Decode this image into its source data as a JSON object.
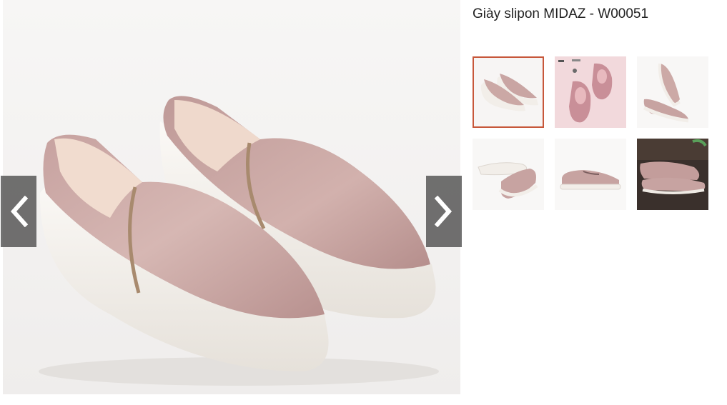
{
  "product": {
    "title": "Giày slipon MIDAZ - W00051"
  },
  "gallery": {
    "main_image_alt": "pink slip-on shoes",
    "prev_icon": "chevron-left-icon",
    "next_icon": "chevron-right-icon",
    "selected_index": 0,
    "thumbnails": [
      {
        "alt": "pair side view"
      },
      {
        "alt": "top view on pink background"
      },
      {
        "alt": "side and back view"
      },
      {
        "alt": "sole and top view"
      },
      {
        "alt": "single shoe side view"
      },
      {
        "alt": "dark background photo"
      }
    ]
  },
  "colors": {
    "shoe": "#c9a6a4",
    "sole": "#f3efe9",
    "accent": "#c7573a",
    "arrow_bg": "#3c3c3c"
  }
}
